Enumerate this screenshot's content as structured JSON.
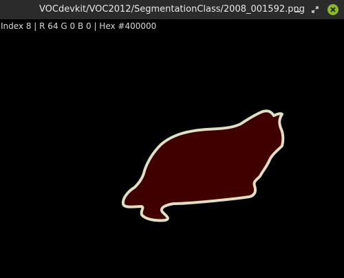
{
  "window": {
    "title": "VOCdevkit/VOC2012/SegmentationClass/2008_001592.png"
  },
  "controls": {
    "minimize_icon": "minimize-icon",
    "restore_icon": "restore-icon",
    "close_icon": "close-icon",
    "close_color": "#8ab92a"
  },
  "status": {
    "pixel_info": "Index 8 | R 64 G 0 B 0 | Hex #400000"
  },
  "image": {
    "background_color": "#000000",
    "region_fill_color": "#400000",
    "boundary_color": "#e0e0c0"
  }
}
